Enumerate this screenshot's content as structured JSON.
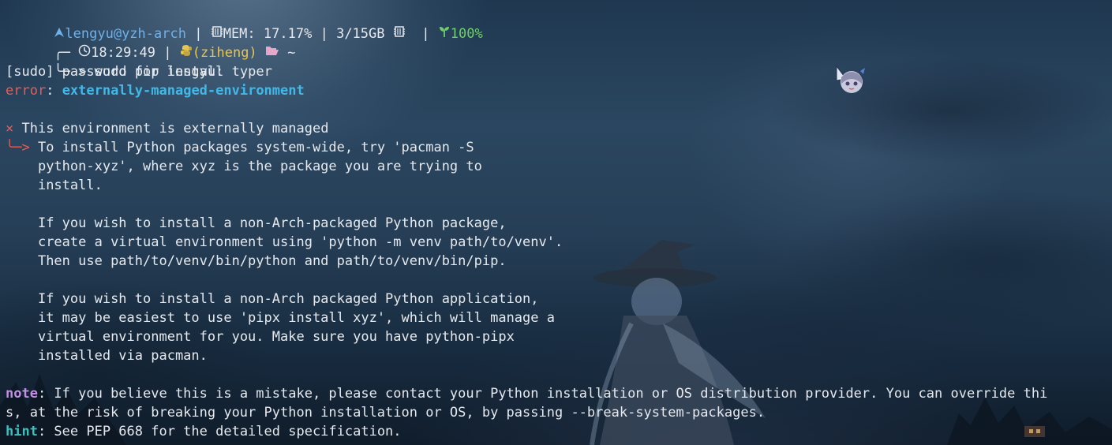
{
  "prompt": {
    "user_host": "lengyu@yzh-arch",
    "separator": "|",
    "mem_label": "MEM:",
    "mem_percent": "17.17%",
    "mem_usage": "3/15GB",
    "battery": "100%",
    "time": "18:29:49",
    "conda_env": "(ziheng)",
    "cwd": "~",
    "prompt_char": ">",
    "command": "sudo pip install typer"
  },
  "output": {
    "sudo_prompt": "[sudo] password for lengyu:",
    "error_label": "error",
    "error_colon": ":",
    "error_code": "externally-managed-environment",
    "cross_mark": "×",
    "summary": "This environment is externally managed",
    "arrow": "╰─>",
    "details": [
      "To install Python packages system-wide, try 'pacman -S",
      "python-xyz', where xyz is the package you are trying to",
      "install.",
      "",
      "If you wish to install a non-Arch-packaged Python package,",
      "create a virtual environment using 'python -m venv path/to/venv'.",
      "Then use path/to/venv/bin/python and path/to/venv/bin/pip.",
      "",
      "If you wish to install a non-Arch packaged Python application,",
      "it may be easiest to use 'pipx install xyz', which will manage a",
      "virtual environment for you. Make sure you have python-pipx",
      "installed via pacman."
    ],
    "note_label": "note",
    "note_text_1": ": If you believe this is a mistake, please contact your Python installation or OS distribution provider. You can override thi",
    "note_text_2": "s, at the risk of breaking your Python installation or OS, by passing --break-system-packages.",
    "hint_label": "hint",
    "hint_text": ": See PEP 668 for the detailed specification."
  },
  "icons": {
    "arch": "arch-logo-icon",
    "mem": "memory-chip-icon",
    "mem2": "memory-chip-icon",
    "battery": "plant-icon",
    "clock": "clock-icon",
    "python": "python-icon",
    "folder": "open-folder-icon",
    "avatar": "anime-girl-avatar-icon"
  },
  "colors": {
    "background": "#1f3850",
    "text": "#e6e9ee",
    "user_host": "#6fb1ea",
    "conda": "#e7c550",
    "battery": "#6fcf6a",
    "error": "#ea5b54",
    "error_code": "#41b9e8",
    "note": "#c38fe6",
    "hint": "#37c2c0"
  }
}
